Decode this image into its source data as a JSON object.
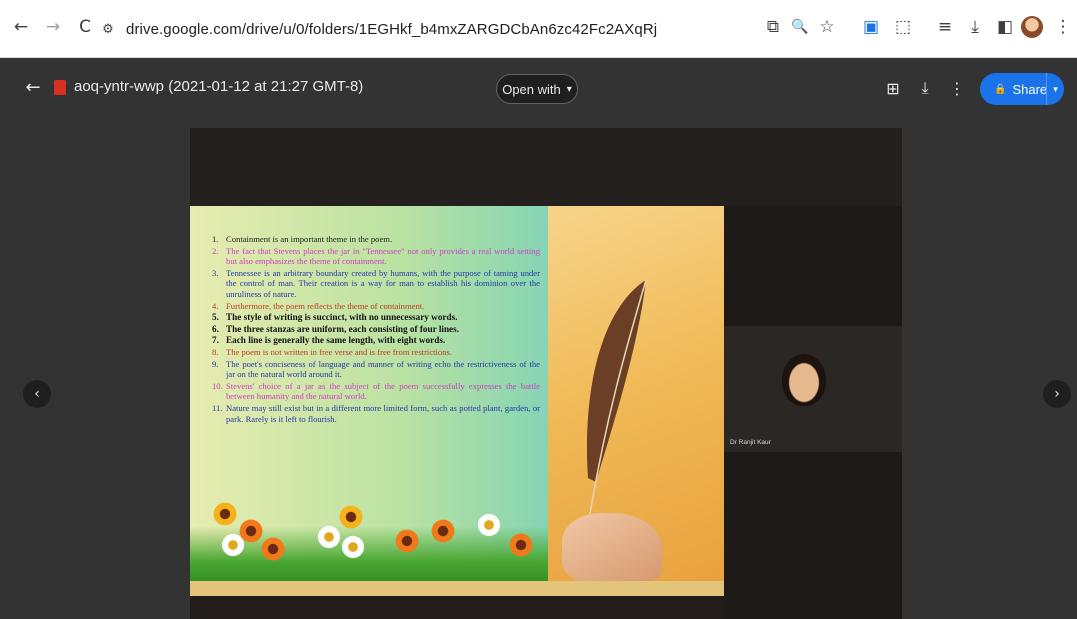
{
  "browser": {
    "url": "drive.google.com/drive/u/0/folders/1EGHkf_b4mxZARGDCbAn6zc42Fc2AXqRj",
    "icons": {
      "back": "←",
      "forward": "→",
      "reload": "C",
      "site_info": "⚙",
      "cast": "⧉",
      "zoom": "🔍",
      "star": "☆",
      "extension_a": "▣",
      "extensions": "⬚",
      "reading_list": "≡",
      "download": "⤓",
      "side_panel": "◧",
      "menu": "⋮"
    }
  },
  "viewer": {
    "file_title": "aoq-yntr-wwp (2021-01-12 at 21:27 GMT-8)",
    "open_with_label": "Open with",
    "open_with_caret": "▾",
    "share_label": "Share",
    "share_lock": "🔒",
    "share_caret": "▾",
    "back_icon": "←",
    "add_icon": "⊞",
    "download_icon": "⤓",
    "more_icon": "⋮",
    "prev_icon": "‹",
    "next_icon": "›"
  },
  "slide": {
    "points": [
      {
        "num": "1.",
        "text": "Containment is an important theme in the poem.",
        "style": "c-black"
      },
      {
        "num": "2.",
        "text": "The fact that Stevens places the jar in \"Tennessee\" not only provides a real world setting but also emphasizes the theme of containment.",
        "style": "c-magenta"
      },
      {
        "num": "3.",
        "text": "Tennessee is an arbitrary boundary created by humans, with the purpose of taming under the control of man. Their creation is a way for man to establish his dominion over the unruliness of nature.",
        "style": "c-blue"
      },
      {
        "num": "4.",
        "text": "Furthermore, the poem reflects the theme of containment.",
        "style": "c-red"
      },
      {
        "num": "5.",
        "text": "The style of writing is succinct, with no unnecessary words.",
        "style": "c-bold"
      },
      {
        "num": "6.",
        "text": "The three stanzas are uniform, each consisting of four lines.",
        "style": "c-bold"
      },
      {
        "num": "7.",
        "text": "Each line is generally the same length, with eight words.",
        "style": "c-bold"
      },
      {
        "num": "8.",
        "text": "The poem is not written in free verse and is free from restrictions.",
        "style": "c-red"
      },
      {
        "num": "9.",
        "text": "The poet's conciseness of language and manner of writing echo the restrictiveness of the jar on the natural world around it.",
        "style": "c-blue"
      },
      {
        "num": "10.",
        "text": "Stevens' choice of a jar as the subject of the poem successfully expresses the battle between humanity and the natural world.",
        "style": "c-magenta"
      },
      {
        "num": "11.",
        "text": "Nature may still exist but in a different more limited form, such as potted plant, garden, or park. Rarely is it left to flourish.",
        "style": "c-blue"
      }
    ]
  },
  "participant": {
    "name": "Dr Ranjit Kaur"
  }
}
